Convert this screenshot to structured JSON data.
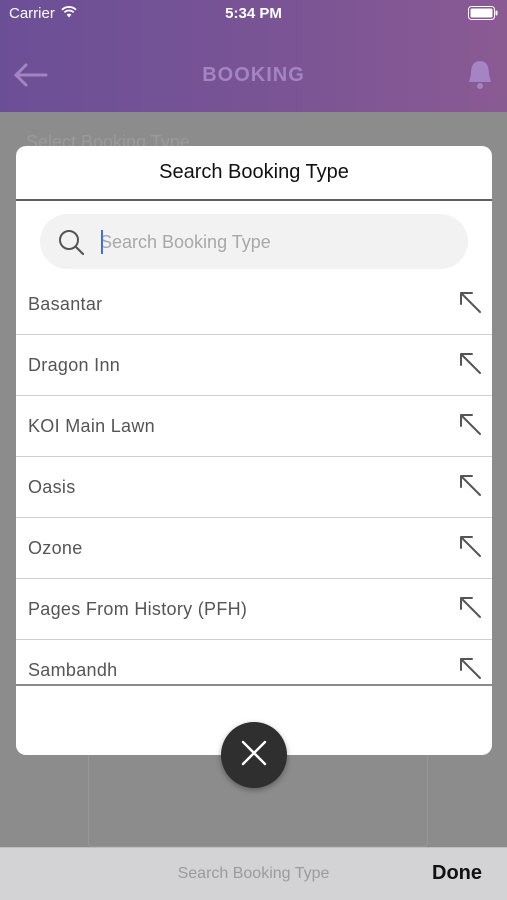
{
  "status_bar": {
    "carrier": "Carrier",
    "time": "5:34 PM"
  },
  "nav": {
    "title": "BOOKING"
  },
  "background": {
    "field_label": "Select Booking Type"
  },
  "modal": {
    "title": "Search Booking Type",
    "search": {
      "placeholder": "Search Booking Type",
      "value": ""
    },
    "items": [
      {
        "label": "Basantar"
      },
      {
        "label": "Dragon Inn"
      },
      {
        "label": "KOI Main Lawn"
      },
      {
        "label": "Oasis"
      },
      {
        "label": "Ozone"
      },
      {
        "label": "Pages From History (PFH)"
      },
      {
        "label": "Sambandh"
      }
    ]
  },
  "toolbar": {
    "placeholder": "Search Booking Type",
    "done_label": "Done"
  },
  "icons": {
    "wifi": "wifi-icon",
    "battery": "battery-icon",
    "back": "back-arrow-icon",
    "bell": "bell-icon",
    "search": "search-icon",
    "select": "arrow-up-left-icon",
    "close": "close-icon"
  },
  "colors": {
    "header_start": "#6b4f96",
    "header_end": "#8a5a93",
    "caret": "#3c6ff0",
    "fab": "#2f2f2f"
  }
}
